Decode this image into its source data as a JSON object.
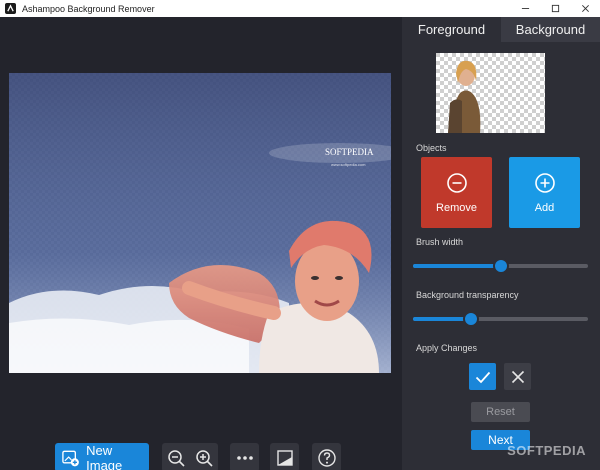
{
  "window": {
    "title": "Ashampoo Background Remover",
    "controls": [
      "minimize-icon",
      "maximize-icon",
      "close-icon"
    ]
  },
  "canvas": {
    "image_text": "SOFTPEDIA",
    "image_subtext": "www.softpedia.com"
  },
  "toolbar": {
    "new_image_label": "New Image",
    "buttons": [
      "image-add-icon",
      "zoom-out-icon",
      "zoom-in-icon",
      "more-icon",
      "compare-icon",
      "help-icon"
    ]
  },
  "panel": {
    "tabs": [
      "Foreground",
      "Background"
    ],
    "active_tab": "Foreground",
    "objects_label": "Objects",
    "remove_label": "Remove",
    "add_label": "Add",
    "brush_width_label": "Brush width",
    "brush_width_value": 0.5,
    "bg_transparency_label": "Background transparency",
    "bg_transparency_value": 0.33,
    "apply_changes_label": "Apply Changes",
    "reset_label": "Reset",
    "next_label": "Next"
  },
  "watermark": "SOFTPEDIA",
  "colors": {
    "accent": "#1a86d9",
    "remove": "#c0392b",
    "add": "#1a9ae6",
    "panel_bg": "#2d2e36",
    "main_bg": "#23242c"
  }
}
